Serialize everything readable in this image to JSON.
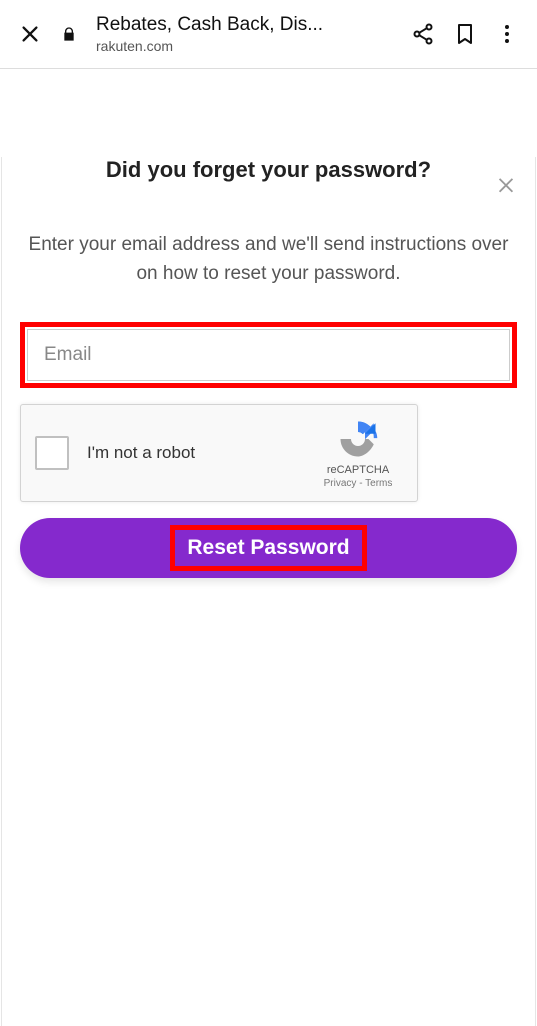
{
  "browser": {
    "page_title": "Rebates, Cash Back, Dis...",
    "domain": "rakuten.com"
  },
  "modal": {
    "heading": "Did you forget your password?",
    "subtext": "Enter your email address and we'll send instructions over on how to reset your password.",
    "email_placeholder": "Email",
    "email_value": "",
    "reset_label": "Reset Password"
  },
  "recaptcha": {
    "label": "I'm not a robot",
    "brand": "reCAPTCHA",
    "privacy": "Privacy",
    "terms": "Terms",
    "separator": "-"
  }
}
